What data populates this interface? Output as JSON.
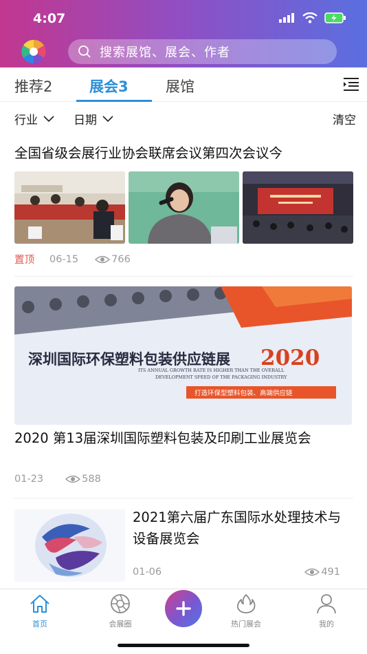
{
  "status_bar": {
    "time": "4:07"
  },
  "search": {
    "placeholder": "搜索展馆、展会、作者"
  },
  "tabs": [
    {
      "label": "推荐2",
      "active": false
    },
    {
      "label": "展会3",
      "active": true
    },
    {
      "label": "展馆",
      "active": false
    }
  ],
  "filters": {
    "industry": "行业",
    "date": "日期",
    "clear": "清空"
  },
  "articles": [
    {
      "title": "全国省级会展行业协会联席会议第四次会议今",
      "pin": "置顶",
      "date": "06-15",
      "views": "766"
    },
    {
      "title": "2020 第13届深圳国际塑料包装及印刷工业展览会",
      "date": "01-23",
      "views": "588",
      "banner": {
        "cn_title": "深圳国际环保塑料包装供应链展",
        "year": "2020",
        "en_line1": "ITS ANNUAL GROWTH RATE IS HIGHER THAN THE OVERALL",
        "en_line2": "DEVELOPMENT SPEED OF THE PACKAGING INDUSTRY",
        "slogan": "打造环保型塑料包装、高端供应链"
      }
    },
    {
      "title": "2021第六届广东国际水处理技术与设备展览会",
      "date": "01-06",
      "views": "491"
    }
  ],
  "bottom_nav": [
    {
      "label": "首页",
      "icon": "home-icon",
      "active": true
    },
    {
      "label": "会展圈",
      "icon": "aperture-icon",
      "active": false
    },
    {
      "label": "热门展会",
      "icon": "flame-icon",
      "active": false
    },
    {
      "label": "我的",
      "icon": "user-icon",
      "active": false
    }
  ],
  "colors": {
    "accent": "#2c8fd8",
    "pin": "#e0574f",
    "header_start": "#c2378f",
    "header_end": "#5a6fe0"
  }
}
